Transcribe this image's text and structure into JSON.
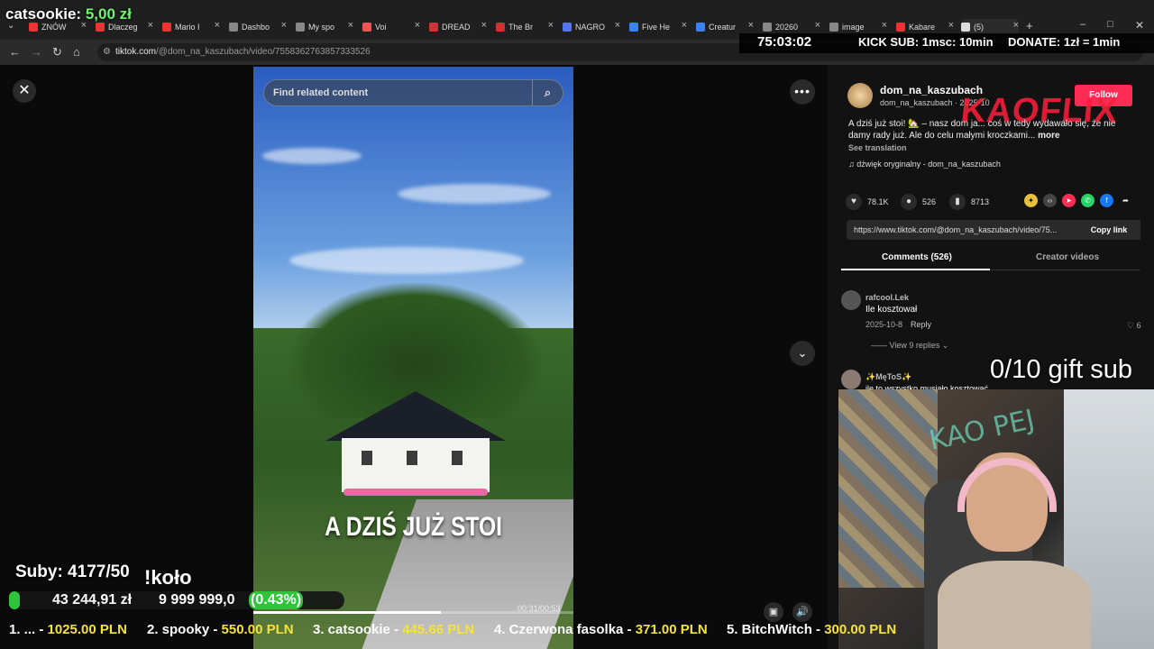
{
  "browser": {
    "tabs": [
      {
        "label": "ZNÓW",
        "color": "#e33"
      },
      {
        "label": "Dlaczeg",
        "color": "#e33"
      },
      {
        "label": "Mario I",
        "color": "#e33"
      },
      {
        "label": "Dashbo",
        "color": "#888"
      },
      {
        "label": "My spo",
        "color": "#888"
      },
      {
        "label": "Voi",
        "color": "#e55"
      },
      {
        "label": "DREAD",
        "color": "#c33"
      },
      {
        "label": "The Br",
        "color": "#c33"
      },
      {
        "label": "NAGRO",
        "color": "#5577ee"
      },
      {
        "label": "Five He",
        "color": "#3b82f6"
      },
      {
        "label": "Creatur",
        "color": "#3b82f6"
      },
      {
        "label": "20260",
        "color": "#888"
      },
      {
        "label": "image",
        "color": "#888"
      },
      {
        "label": "Kabare",
        "color": "#e33"
      },
      {
        "label": "(5)",
        "color": "#ddd"
      }
    ],
    "url_host": "tiktok.com",
    "url_path": "/@dom_na_kaszubach/video/7558362763857333526"
  },
  "overlay": {
    "top_left_name": "catsookie:",
    "top_left_amount": "5,00 zł",
    "timer": "75:03:02",
    "kick_sub": "KICK SUB: 1msc: 10min",
    "donate": "DONATE: 1zł = 1min",
    "gift_sub": "0/10 gift sub",
    "cam_scribble": "KAO PEJ",
    "subs": "Suby: 4177/50",
    "kolo": "!koło",
    "goal_current": "43 244,91 zł",
    "goal_target": "9 999 999,0",
    "goal_percent_label": "(0.43%)",
    "goal_fraction": 0.0043,
    "ticker": [
      {
        "name": "1. ... - ",
        "amount": "1025.00 PLN"
      },
      {
        "name": "2. spooky - ",
        "amount": "550.00 PLN"
      },
      {
        "name": "3. catsookie - ",
        "amount": "445.66 PLN"
      },
      {
        "name": "4. Czerwona fasolka - ",
        "amount": "371.00 PLN"
      },
      {
        "name": "5. BitchWitch - ",
        "amount": "300.00 PLN"
      }
    ]
  },
  "video": {
    "search_placeholder": "Find related content",
    "caption": "A DZIŚ JUŻ STOI",
    "timecode": "00:31/00:53",
    "progress": 0.585
  },
  "panel": {
    "username": "dom_na_kaszubach",
    "subtitle": "dom_na_kaszubach · 2025-10",
    "follow_label": "Follow",
    "watermark": "KAOFLIX",
    "description": "A dziś już stoi! 🏡 – nasz dom ja... coś w tedy wydawało się, że nie damy rady już. Ale do celu małymi kroczkami...",
    "more_label": "more",
    "see_translation": "See translation",
    "music": "dźwięk oryginalny - dom_na_kaszubach",
    "likes": "78.1K",
    "comments_count": "526",
    "saves": "8713",
    "link": "https://www.tiktok.com/@dom_na_kaszubach/video/75...",
    "copy_link": "Copy link",
    "tab_comments": "Comments (526)",
    "tab_creator": "Creator videos",
    "comments": [
      {
        "user": "rafcool.Lek",
        "text": "Ile kosztował",
        "date": "2025-10-8",
        "reply": "Reply",
        "likes": "6",
        "view_replies": "View 9 replies"
      },
      {
        "user": "✨MęToS✨",
        "text": "ile to wszystko musiało kosztować"
      }
    ]
  }
}
